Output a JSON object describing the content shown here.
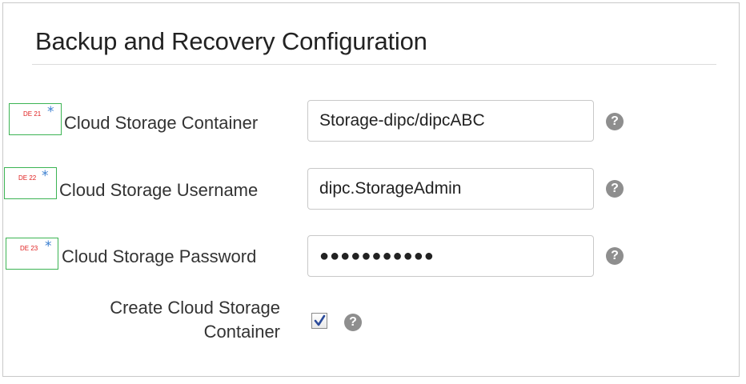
{
  "section": {
    "title": "Backup and Recovery Configuration"
  },
  "fields": {
    "container": {
      "annotation_code": "DE 21",
      "label": "Cloud Storage Container",
      "value": "Storage-dipc/dipcABC",
      "help": "?"
    },
    "username": {
      "annotation_code": "DE 22",
      "label": "Cloud Storage Username",
      "value": "dipc.StorageAdmin",
      "help": "?"
    },
    "password": {
      "annotation_code": "DE 23",
      "label": "Cloud Storage Password",
      "value": "●●●●●●●●●●●",
      "help": "?"
    },
    "create_container": {
      "label_line1": "Create Cloud Storage",
      "label_line2": "Container",
      "checked": true,
      "help": "?"
    }
  },
  "annotations": {
    "star": "*"
  },
  "colors": {
    "annotation_border": "#3cb453",
    "annotation_code": "#e02020",
    "required_star": "#3a7fd0",
    "help_icon": "#8e8e8e",
    "input_border": "#c9c9c9"
  }
}
